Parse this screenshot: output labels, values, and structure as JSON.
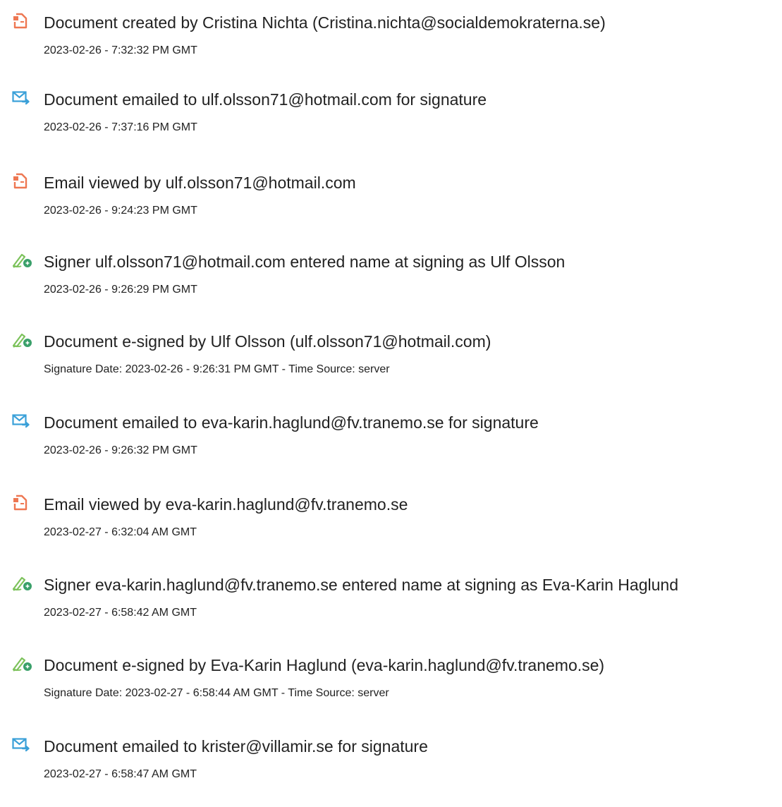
{
  "colors": {
    "doc_icon": "#ee7752",
    "mail_icon": "#3aa0d8",
    "sign_icon_pen": "#7cc25b",
    "sign_icon_badge": "#3aa06a",
    "text": "#222222"
  },
  "events": [
    {
      "icon": "document-icon",
      "title": "Document created by Cristina Nichta (Cristina.nichta@socialdemokraterna.se)",
      "date": "2023-02-26 - 7:32:32 PM GMT"
    },
    {
      "icon": "email-icon",
      "title": "Document emailed to ulf.olsson71@hotmail.com for signature",
      "date": "2023-02-26 - 7:37:16 PM GMT"
    },
    {
      "icon": "document-icon",
      "title": "Email viewed by ulf.olsson71@hotmail.com",
      "date": "2023-02-26 - 9:24:23 PM GMT"
    },
    {
      "icon": "signature-icon",
      "title": "Signer ulf.olsson71@hotmail.com entered name at signing as Ulf Olsson",
      "date": "2023-02-26 - 9:26:29 PM GMT"
    },
    {
      "icon": "signature-icon",
      "title": "Document e-signed by Ulf Olsson (ulf.olsson71@hotmail.com)",
      "date": "Signature Date: 2023-02-26 - 9:26:31 PM GMT - Time Source: server"
    },
    {
      "icon": "email-icon",
      "title": "Document emailed to eva-karin.haglund@fv.tranemo.se for signature",
      "date": "2023-02-26 - 9:26:32 PM GMT"
    },
    {
      "icon": "document-icon",
      "title": "Email viewed by eva-karin.haglund@fv.tranemo.se",
      "date": "2023-02-27 - 6:32:04 AM GMT"
    },
    {
      "icon": "signature-icon",
      "title": "Signer eva-karin.haglund@fv.tranemo.se entered name at signing as Eva-Karin Haglund",
      "date": "2023-02-27 - 6:58:42 AM GMT"
    },
    {
      "icon": "signature-icon",
      "title": "Document e-signed by Eva-Karin Haglund (eva-karin.haglund@fv.tranemo.se)",
      "date": "Signature Date: 2023-02-27 - 6:58:44 AM GMT - Time Source: server"
    },
    {
      "icon": "email-icon",
      "title": "Document emailed to krister@villamir.se for signature",
      "date": "2023-02-27 - 6:58:47 AM GMT"
    }
  ]
}
